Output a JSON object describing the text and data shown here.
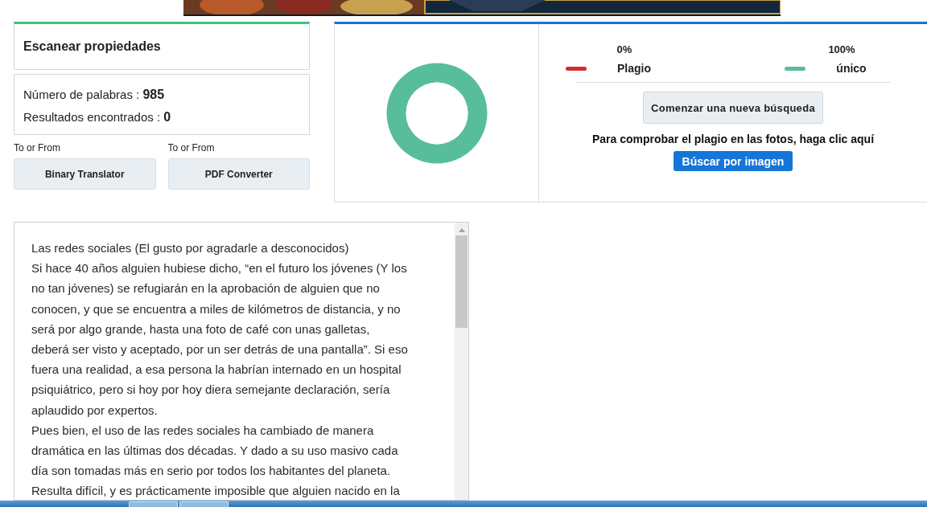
{
  "scan_panel": {
    "title": "Escanear propiedades"
  },
  "stats": [
    {
      "label": "Número de palabras : ",
      "value": "985"
    },
    {
      "label": "Resultados encontrados : ",
      "value": "0"
    }
  ],
  "tools": [
    {
      "caption": "To or From",
      "button": "Binary Translator"
    },
    {
      "caption": "To or From",
      "button": "PDF Converter"
    }
  ],
  "result": {
    "chart_data": {
      "type": "donut",
      "values": [
        0,
        100
      ]
    },
    "legend": [
      {
        "percent": "0%",
        "label": "Plagio",
        "color": "#d92b2b"
      },
      {
        "percent": "100%",
        "label": "único",
        "color": "#58bd9c"
      }
    ],
    "new_search_button": "Comenzar una nueva búsqueda",
    "image_hint": "Para comprobar el plagio en las fotos, haga clic aquí",
    "image_search_button": "Búscar por imagen"
  },
  "text_area": {
    "paragraphs": [
      [
        "Las redes sociales (El gusto por agradarle a desconocidos)"
      ],
      [
        "Si hace 40 años alguien hubiese dicho, “en el futuro los jóvenes (Y los",
        "no tan jóvenes) se refugiarán en la aprobación de alguien que no",
        "conocen, y que se encuentra a miles de kilómetros de distancia, y no",
        "será por algo grande, hasta una foto de café con unas galletas,",
        "deberá ser visto y aceptado, por un ser detrás de una pantalla”. Si eso",
        "fuera una realidad, a esa persona  la habrían internado en un hospital",
        "psiquiátrico, pero si hoy por hoy diera semejante declaración, sería",
        "aplaudido por expertos."
      ],
      [
        "Pues bien, el uso de las redes sociales ha cambiado de manera",
        "dramática en las últimas dos décadas.  Y dado a su uso masivo cada",
        "día son tomadas más en serio por todos los habitantes del planeta.",
        "Resulta difícil, y es prácticamente imposible que alguien nacido en la"
      ]
    ]
  }
}
